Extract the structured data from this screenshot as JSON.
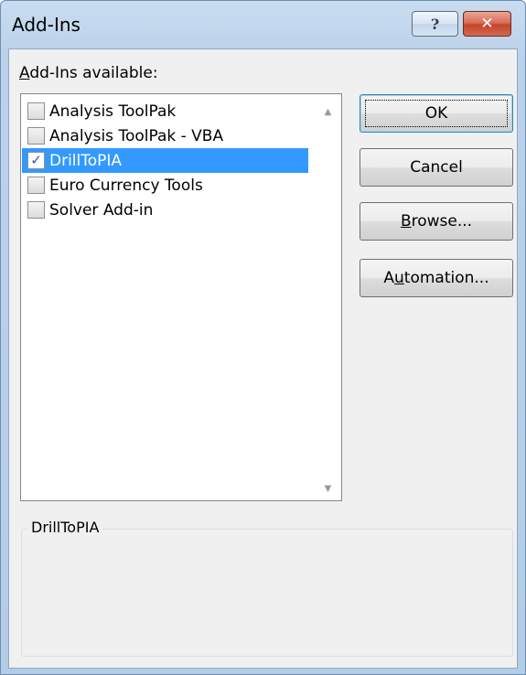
{
  "window": {
    "title": "Add-Ins",
    "help_glyph": "?",
    "close_glyph": "✕"
  },
  "addins": {
    "label_accel": "A",
    "label_rest": "dd-Ins available:",
    "items": [
      {
        "label": "Analysis ToolPak",
        "checked": false,
        "selected": false
      },
      {
        "label": "Analysis ToolPak - VBA",
        "checked": false,
        "selected": false
      },
      {
        "label": "DrillToPIA",
        "checked": true,
        "selected": true
      },
      {
        "label": "Euro Currency Tools",
        "checked": false,
        "selected": false
      },
      {
        "label": "Solver Add-in",
        "checked": false,
        "selected": false
      }
    ],
    "check_glyph": "✓",
    "scroll_up_icon": "▲",
    "scroll_down_icon": "▼"
  },
  "buttons": {
    "ok": "OK",
    "cancel": "Cancel",
    "browse_accel": "B",
    "browse_rest": "rowse...",
    "automation_pre": "A",
    "automation_accel": "u",
    "automation_rest": "tomation..."
  },
  "description": {
    "title": "DrillToPIA"
  },
  "colors": {
    "selection": "#3399ff",
    "close_button": "#c4442c",
    "frame": "#b5cce6"
  }
}
